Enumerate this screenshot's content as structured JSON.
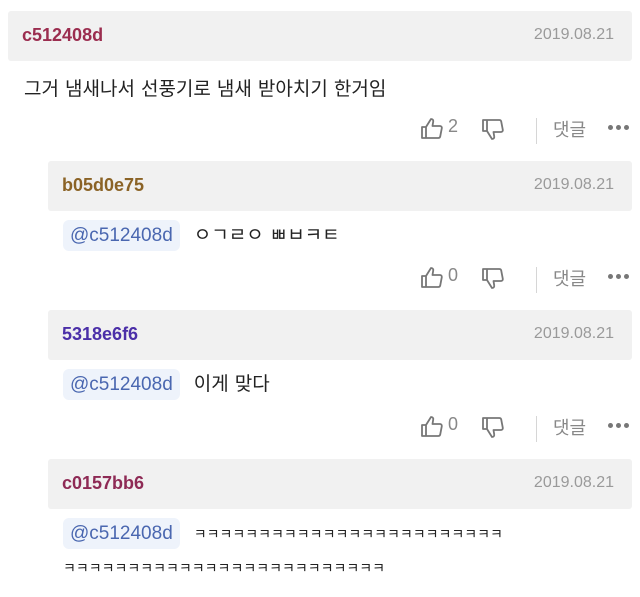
{
  "comments": [
    {
      "author": "c512408d",
      "author_color": "#9b2d4f",
      "date": "2019.08.21",
      "text": "그거 냄새나서 선풍기로 냄새 받아치기 한거임",
      "likes": "2",
      "reply_label": "댓글"
    },
    {
      "author": "b05d0e75",
      "author_color": "#8b6326",
      "date": "2019.08.21",
      "mention": "@c512408d",
      "text": "ㅇㄱㄹㅇ ㅃㅂㅋㅌ",
      "likes": "0",
      "reply_label": "댓글"
    },
    {
      "author": "5318e6f6",
      "author_color": "#4b2fa8",
      "date": "2019.08.21",
      "mention": "@c512408d",
      "text": "이게 맞다",
      "likes": "0",
      "reply_label": "댓글"
    },
    {
      "author": "c0157bb6",
      "author_color": "#8e2a55",
      "date": "2019.08.21",
      "mention": "@c512408d",
      "text_line1": "ㅋㅋㅋㅋㅋㅋㅋㅋㅋㅋㅋㅋㅋㅋㅋㅋㅋㅋㅋㅋㅋㅋㅋㅋ",
      "text_line2": "ㅋㅋㅋㅋㅋㅋㅋㅋㅋㅋㅋㅋㅋㅋㅋㅋㅋㅋㅋㅋㅋㅋㅋㅋㅋ"
    }
  ]
}
